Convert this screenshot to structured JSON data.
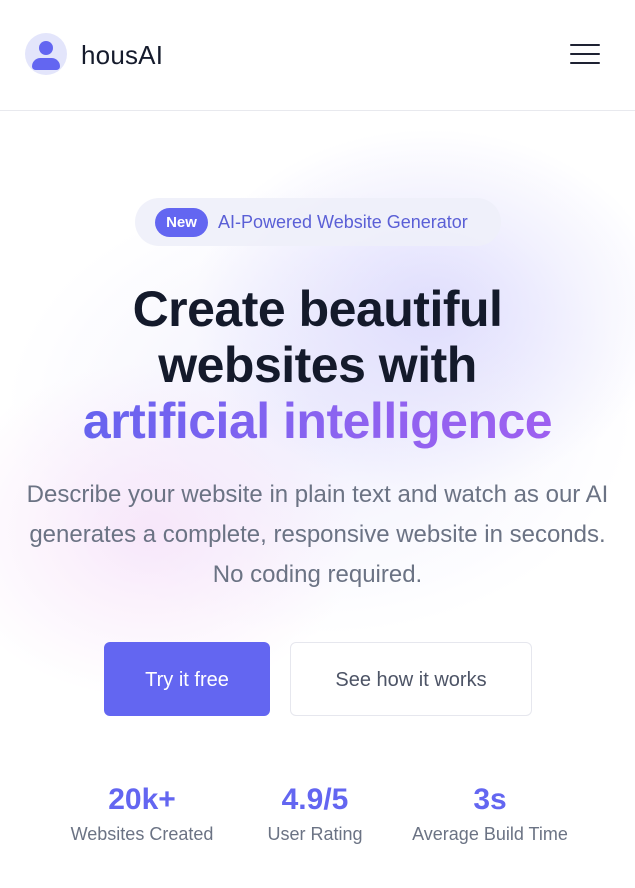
{
  "header": {
    "brand": "housAI",
    "avatar_icon": "user-avatar-icon",
    "menu_icon": "hamburger-menu-icon"
  },
  "hero": {
    "badge": {
      "tag": "New",
      "text": "AI-Powered Website Generator"
    },
    "headline": {
      "line1": "Create beautiful",
      "line2": "websites with",
      "accent": "artificial intelligence"
    },
    "description": "Describe your website in plain text and watch as our AI generates a complete, responsive website in seconds. No coding required.",
    "primary_cta": "Try it free",
    "secondary_cta": "See how it works"
  },
  "stats": [
    {
      "value": "20k+",
      "label": "Websites Created"
    },
    {
      "value": "4.9/5",
      "label": "User Rating"
    },
    {
      "value": "3s",
      "label": "Average Build Time"
    }
  ],
  "colors": {
    "accent": "#6366f1",
    "accent_gradient_end": "#a45ff0",
    "heading": "#141a2b",
    "muted_text": "#6b7384"
  }
}
